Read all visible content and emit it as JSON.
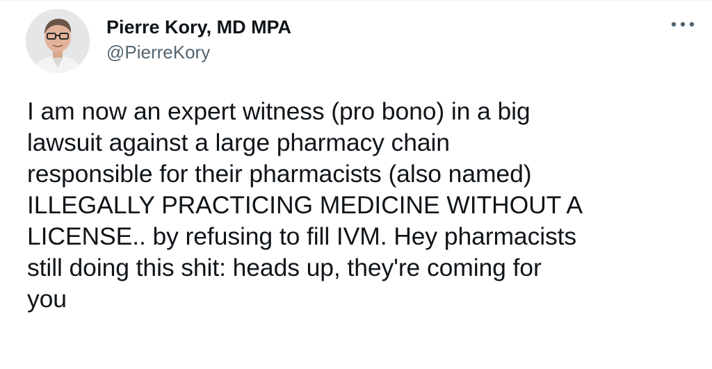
{
  "tweet": {
    "author": {
      "display_name": "Pierre Kory, MD MPA",
      "handle": "@PierreKory",
      "avatar_icon": "profile-photo"
    },
    "more_icon": "more-options-icon",
    "text": "I am now an expert witness (pro bono) in a big\nlawsuit against a large pharmacy chain\nresponsible for their pharmacists (also named)\nILLEGALLY PRACTICING MEDICINE WITHOUT A\nLICENSE.. by refusing to fill IVM. Hey pharmacists\nstill doing this shit: heads up, they're coming for\nyou"
  },
  "colors": {
    "text_primary": "#0f1419",
    "text_secondary": "#536471",
    "background": "#ffffff"
  }
}
